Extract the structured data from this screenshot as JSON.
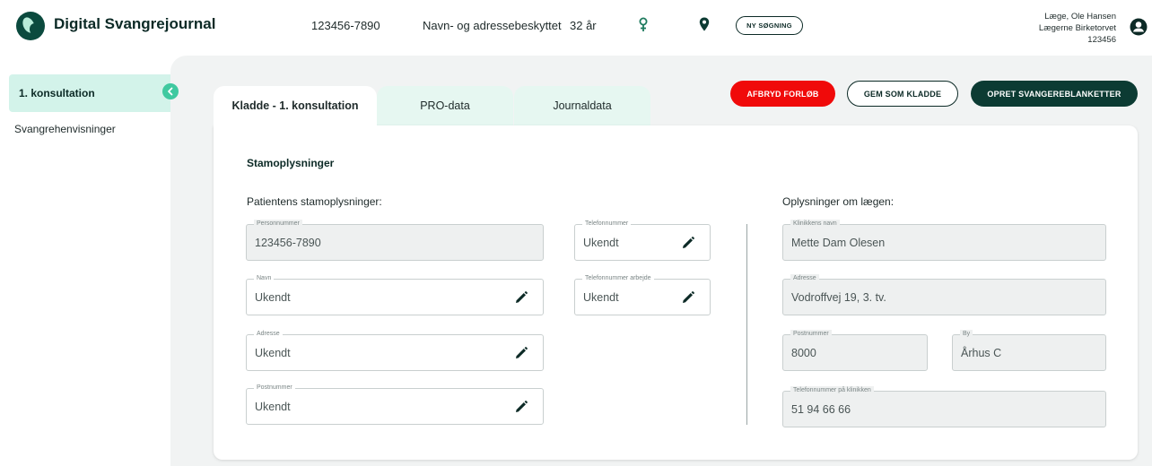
{
  "header": {
    "app_title": "Digital Svangrejournal",
    "cpr": "123456-7890",
    "protection": "Navn- og adressebeskyttet",
    "age": "32 år",
    "search_button": "NY SØGNING",
    "user_role_name": "Læge, Ole Hansen",
    "user_clinic": "Lægerne Birketorvet",
    "user_id": "123456"
  },
  "sidebar": {
    "items": [
      {
        "label": "1. konsultation",
        "active": true
      },
      {
        "label": "Svangrehenvisninger",
        "active": false
      }
    ]
  },
  "tabs": [
    {
      "label": "Kladde - 1. konsultation",
      "active": true
    },
    {
      "label": "PRO-data",
      "active": false
    },
    {
      "label": "Journaldata",
      "active": false
    }
  ],
  "actions": {
    "abort": "AFBRYD FORLØB",
    "save_draft": "GEM SOM KLADDE",
    "create": "OPRET SVANGEREBLANKETTER"
  },
  "form": {
    "section_title": "Stamoplysninger",
    "patient_title": "Patientens stamoplysninger:",
    "doctor_title": "Oplysninger om lægen:",
    "patient_fields": {
      "cpr": {
        "label": "Personnummer",
        "value": "123456-7890"
      },
      "name": {
        "label": "Navn",
        "value": "Ukendt"
      },
      "address": {
        "label": "Adresse",
        "value": "Ukendt"
      },
      "postal": {
        "label": "Postnummer",
        "value": "Ukendt"
      },
      "phone": {
        "label": "Telefonnummer",
        "value": "Ukendt"
      },
      "phone_work": {
        "label": "Telefonnummer arbejde",
        "value": "Ukendt"
      }
    },
    "doctor_fields": {
      "clinic_name": {
        "label": "Klinikkens navn",
        "value": "Mette Dam Olesen"
      },
      "address": {
        "label": "Adresse",
        "value": "Vodroffvej 19, 3. tv."
      },
      "postal": {
        "label": "Postnummer",
        "value": "8000"
      },
      "city": {
        "label": "By",
        "value": "Århus C"
      },
      "clinic_phone": {
        "label": "Telefonnummer på klinikken",
        "value": "51 94 66 66"
      }
    }
  },
  "colors": {
    "brand_dark": "#0c3b33",
    "accent_mint": "#d3f3ea",
    "accent_green": "#3fc9a0",
    "danger": "#f00a0a"
  }
}
